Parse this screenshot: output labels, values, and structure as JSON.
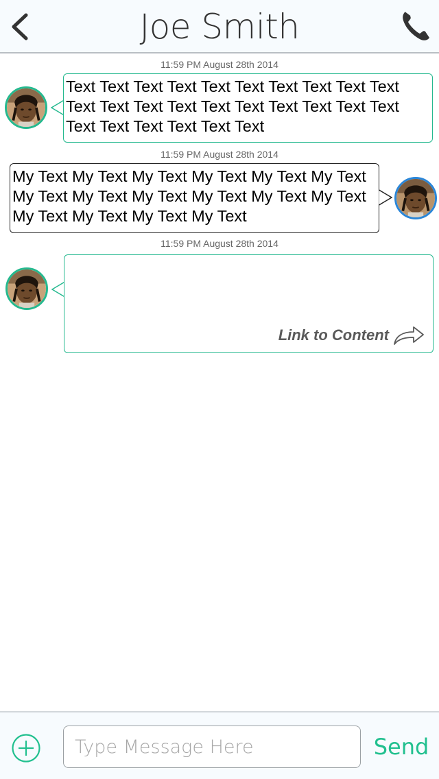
{
  "header": {
    "title": "Joe Smith",
    "back_icon": "chevron-left-icon",
    "call_icon": "phone-icon"
  },
  "colors": {
    "accent_green": "#25b98f",
    "avatar_blue": "#2a86d8",
    "header_bg": "#f7fbfe"
  },
  "messages": [
    {
      "timestamp": "11:59 PM August 28th 2014",
      "direction": "incoming",
      "text": "Text Text Text Text Text Text Text Text Text Text Text Text Text Text Text Text Text Text Text Text Text Text Text Text Text Text"
    },
    {
      "timestamp": "11:59 PM August 28th 2014",
      "direction": "outgoing",
      "text": "My Text My Text My Text My Text My Text My Text My Text My Text My Text My Text My Text My Text My Text My Text My Text My Text"
    },
    {
      "timestamp": "11:59 PM August 28th 2014",
      "direction": "incoming",
      "link_label": "Link to Content",
      "link_icon": "share-arrow-icon"
    }
  ],
  "composer": {
    "add_icon": "plus-circle-icon",
    "placeholder": "Type Message Here",
    "value": "",
    "send_label": "Send"
  }
}
